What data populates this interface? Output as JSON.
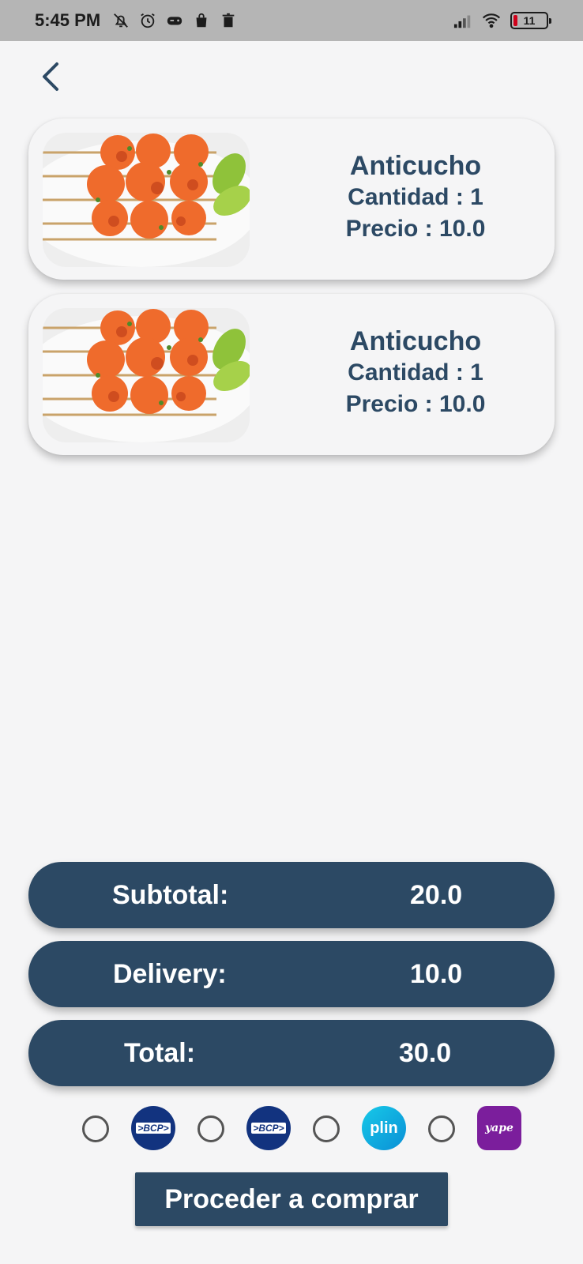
{
  "status_bar": {
    "time": "5:45 PM",
    "battery": "11",
    "icons_left": [
      "bell-off-icon",
      "alarm-icon",
      "game-controller-icon",
      "shopping-bag-icon",
      "trash-icon"
    ],
    "icons_right": [
      "signal-icon",
      "wifi-icon",
      "battery-icon"
    ]
  },
  "nav": {
    "back_icon": "chevron-left-icon"
  },
  "cart": {
    "items": [
      {
        "name": "Anticucho",
        "quantity_text": "Cantidad : 1",
        "price_text": "Precio : 10.0",
        "image": "grilled-shrimp-skewers"
      },
      {
        "name": "Anticucho",
        "quantity_text": "Cantidad : 1",
        "price_text": "Precio : 10.0",
        "image": "grilled-shrimp-skewers"
      }
    ]
  },
  "summary": {
    "subtotal_label": "Subtotal:",
    "subtotal_value": "20.0",
    "delivery_label": "Delivery:",
    "delivery_value": "10.0",
    "total_label": "Total:",
    "total_value": "30.0"
  },
  "payment": {
    "options": [
      {
        "logo_text": ">BCP>",
        "selected": false
      },
      {
        "logo_text": ">BCP>",
        "selected": false
      },
      {
        "logo_text": "plin",
        "selected": false
      },
      {
        "logo_text": "yape",
        "selected": false
      }
    ]
  },
  "buy_button_label": "Proceder a comprar",
  "colors": {
    "primary": "#2c4964",
    "background": "#f5f5f6",
    "status_bar": "#b5b5b5"
  }
}
